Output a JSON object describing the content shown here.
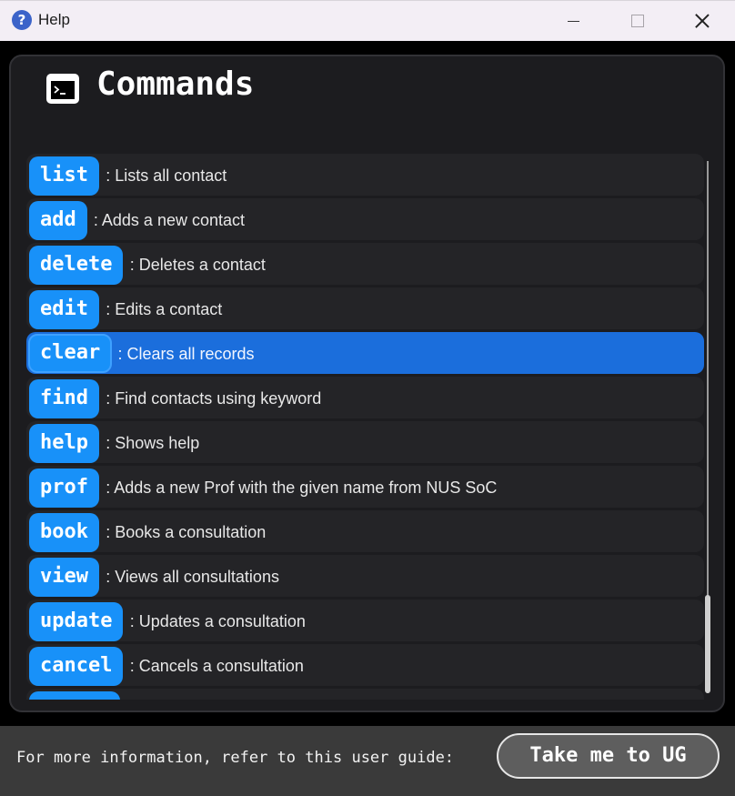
{
  "window": {
    "title": "Help",
    "icon": "help-question-icon"
  },
  "panel": {
    "title": "Commands",
    "icon": "terminal-icon"
  },
  "commands": [
    {
      "name": "list",
      "desc": ": Lists all contact"
    },
    {
      "name": "add",
      "desc": ": Adds a new contact"
    },
    {
      "name": "delete",
      "desc": ": Deletes a contact"
    },
    {
      "name": "edit",
      "desc": ": Edits a contact"
    },
    {
      "name": "clear",
      "desc": ": Clears all records",
      "selected": true
    },
    {
      "name": "find",
      "desc": ": Find contacts using keyword"
    },
    {
      "name": "help",
      "desc": ": Shows help"
    },
    {
      "name": "prof",
      "desc": ": Adds a new Prof with the given name from NUS SoC"
    },
    {
      "name": "book",
      "desc": ": Books a consultation"
    },
    {
      "name": "view",
      "desc": ": Views all consultations"
    },
    {
      "name": "update",
      "desc": ": Updates a consultation"
    },
    {
      "name": "cancel",
      "desc": ": Cancels a consultation"
    },
    {
      "name": "",
      "desc": ""
    }
  ],
  "footer": {
    "text": "For more information, refer to this user guide:",
    "button_label": "Take me to UG"
  },
  "colors": {
    "accent": "#1891f9",
    "selected_row": "#1b6edc",
    "panel_bg": "#1c1c1f",
    "footer_bg": "#3a3a3a"
  }
}
